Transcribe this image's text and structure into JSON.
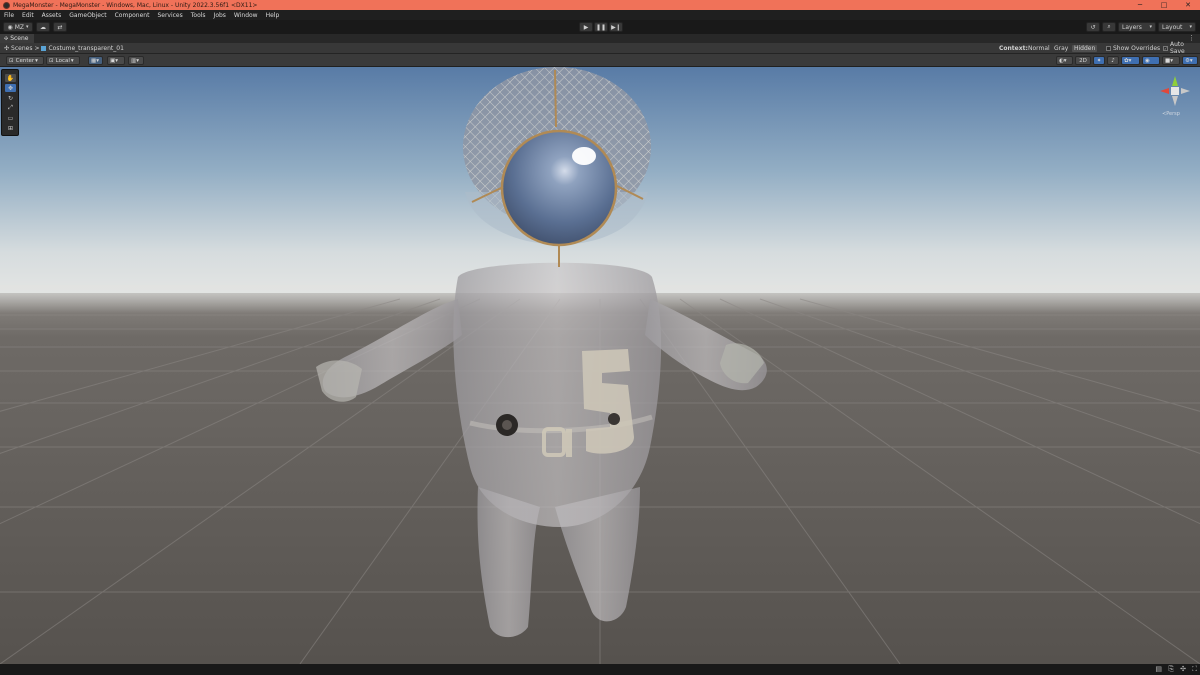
{
  "window": {
    "title": "MegaMonster - MegaMonster - Windows, Mac, Linux - Unity 2022.3.56f1 <DX11>",
    "controls": [
      "─",
      "□",
      "✕"
    ]
  },
  "menu": [
    "File",
    "Edit",
    "Assets",
    "GameObject",
    "Component",
    "Services",
    "Tools",
    "Jobs",
    "Window",
    "Help"
  ],
  "toolbar": {
    "account": "MZ",
    "layers_label": "Layers",
    "layout_label": "Layout"
  },
  "scene_tab": {
    "label": "Scene"
  },
  "breadcrumb": {
    "root": "Scenes",
    "separator": ">",
    "current": "Costume_transparent_01"
  },
  "context": {
    "label": "Context:",
    "options": [
      "Normal",
      "Gray",
      "Hidden"
    ],
    "selected": "Hidden",
    "show_overrides": "Show Overrides",
    "auto_save": "Auto Save"
  },
  "scene_toolbar": {
    "pivot_mode": "Center",
    "pivot_rotation": "Local",
    "mode_2d": "2D"
  },
  "gizmo": {
    "persp_label": "≺Persp"
  },
  "colors": {
    "titlebar": "#f07259",
    "menubar": "#1f1f1f",
    "panel": "#383838",
    "sky_top": "#5e7ea6",
    "horizon": "#d9dde0",
    "ground": "#5f5a56",
    "accent": "#3f6fb1"
  }
}
